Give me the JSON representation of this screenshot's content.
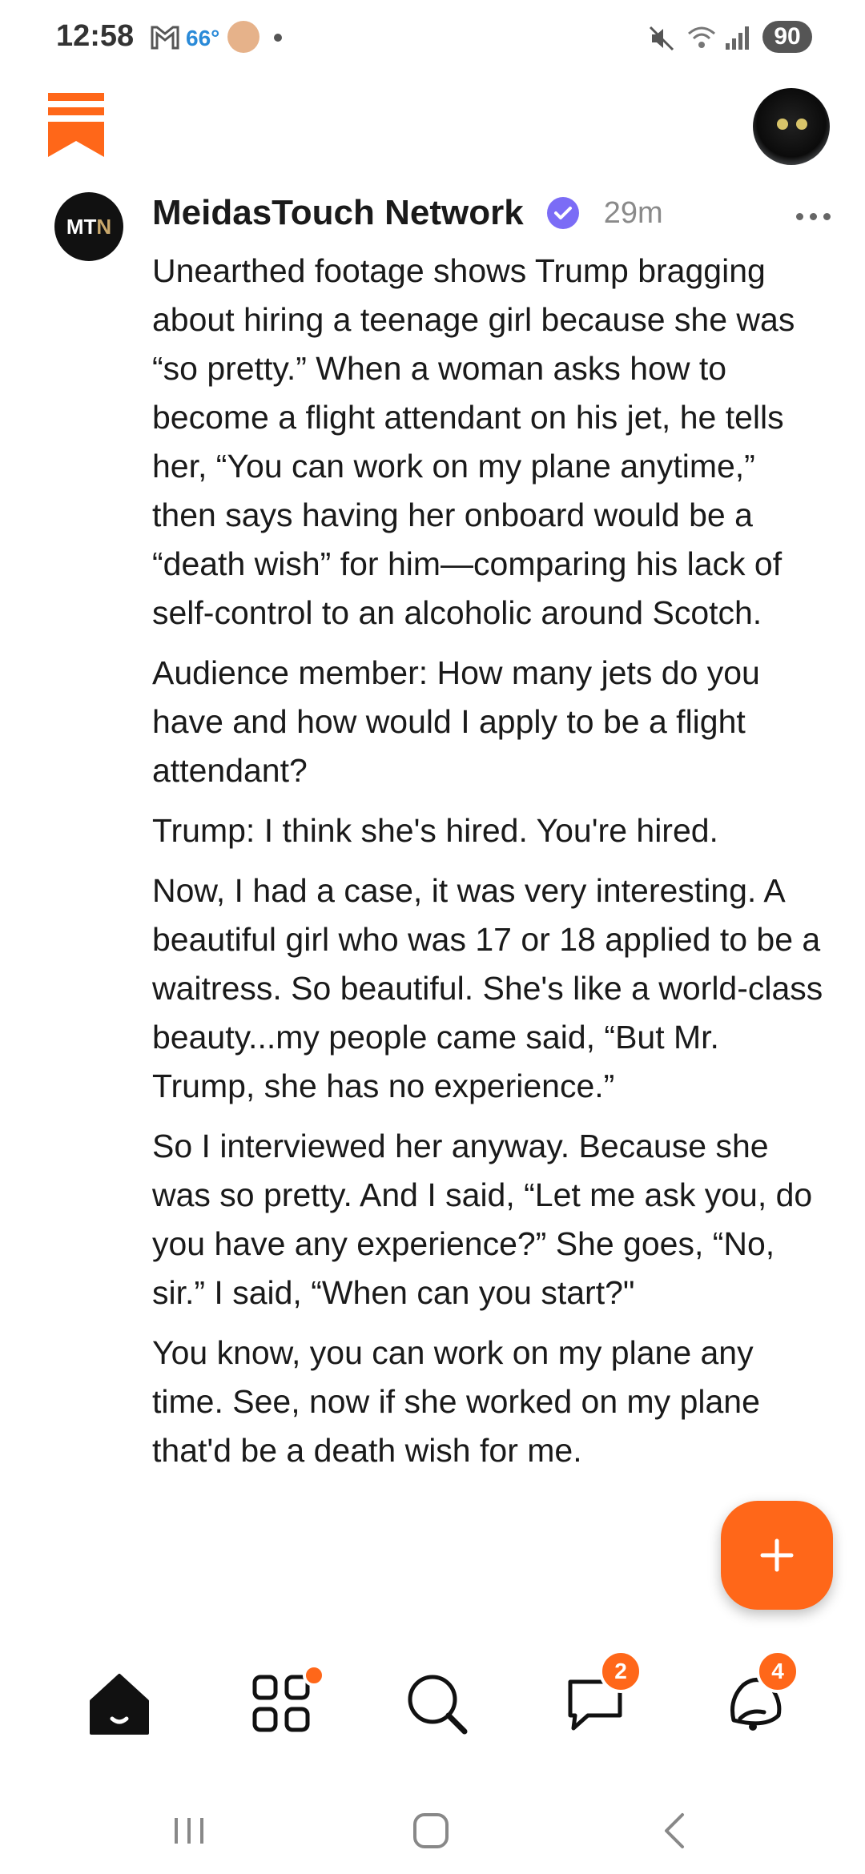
{
  "status_bar": {
    "time": "12:58",
    "temperature": "66°",
    "battery": "90",
    "icons": [
      "gmail-icon",
      "weather-avatar-icon",
      "notification-dot",
      "mute-icon",
      "wifi-icon",
      "signal-icon",
      "battery-icon"
    ]
  },
  "header": {
    "logo_icon": "substack-bookmark-icon",
    "profile_icon": "cat-avatar"
  },
  "post": {
    "avatar_text_main": "MT",
    "avatar_text_accent": "N",
    "author": "MeidasTouch Network",
    "verified_icon": "verified-badge-icon",
    "time": "29m",
    "paragraphs": [
      "Unearthed footage shows Trump bragging about hiring a teenage girl because she was “so pretty.” When a woman asks how to become a flight attendant on his jet, he tells her, “You can work on my plane anytime,” then says having her onboard would be a “death wish” for him—comparing his lack of self-control to an alcoholic around Scotch.",
      "Audience member: How many jets do you have and how would I apply to be a flight attendant?",
      "Trump: I think she's hired. You're hired.",
      "Now, I had a case, it was very interesting. A beautiful girl who was 17 or 18 applied to be a waitress. So beautiful. She's like a world-class beauty...my people came said, “But Mr. Trump, she has no experience.”",
      "So I interviewed her anyway. Because she was so pretty. And I said, “Let me ask you, do you have any experience?” She goes, “No, sir.” I said, “When can you start?\"",
      "You know, you can work on my plane any time. See, now if she worked on my plane that'd be a death wish for me."
    ]
  },
  "fab": {
    "icon": "plus-icon"
  },
  "bottom_nav": {
    "items": [
      {
        "name": "home",
        "icon": "home-icon",
        "badge": ""
      },
      {
        "name": "browse",
        "icon": "grid-icon",
        "badge": "dot"
      },
      {
        "name": "search",
        "icon": "search-icon",
        "badge": ""
      },
      {
        "name": "chat",
        "icon": "chat-icon",
        "badge": "2"
      },
      {
        "name": "activity",
        "icon": "bell-icon",
        "badge": "4"
      }
    ]
  },
  "colors": {
    "accent": "#ff6719",
    "verified": "#7b6cf6",
    "text": "#1a1a1a",
    "muted": "#8a8a8a"
  }
}
